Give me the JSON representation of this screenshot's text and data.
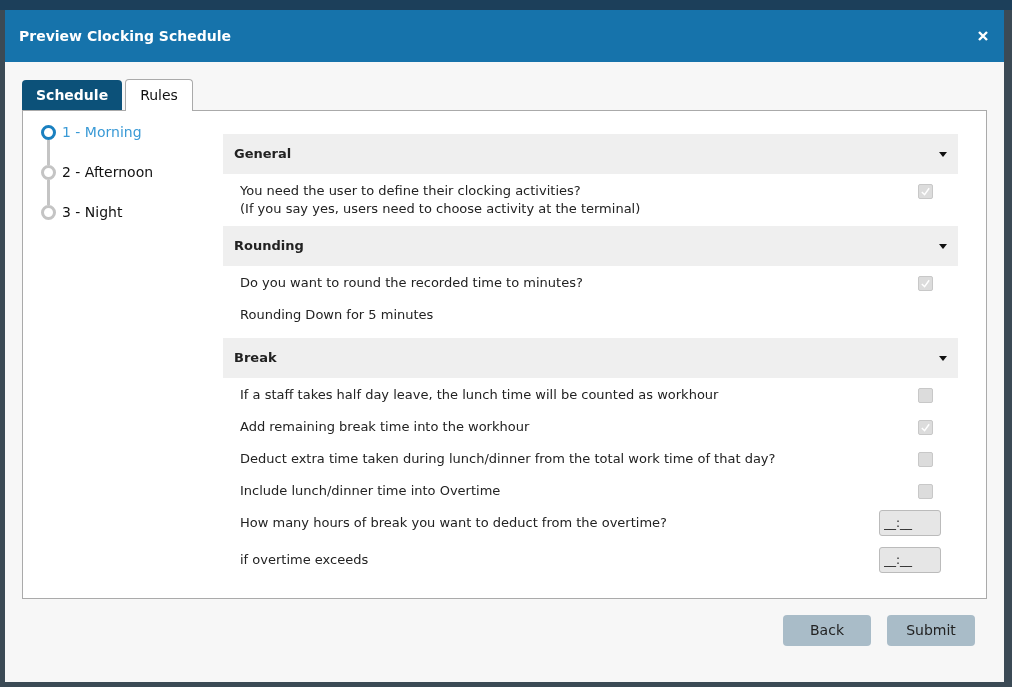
{
  "dialog": {
    "title": "Preview Clocking Schedule"
  },
  "tabs": [
    {
      "label": "Schedule",
      "selected": false
    },
    {
      "label": "Rules",
      "selected": true
    }
  ],
  "steps": [
    {
      "label": "1 - Morning",
      "selected": true
    },
    {
      "label": "2 - Afternoon",
      "selected": false
    },
    {
      "label": "3 - Night",
      "selected": false
    }
  ],
  "sections": [
    {
      "title": "General",
      "rows": [
        {
          "kind": "checkbox",
          "text": "You need the user to define their clocking activities?\n(If you say yes, users need to choose activity at the terminal)",
          "checked": true
        }
      ]
    },
    {
      "title": "Rounding",
      "rows": [
        {
          "kind": "checkbox",
          "text": "Do you want to round the recorded time to minutes?",
          "checked": true
        },
        {
          "kind": "text",
          "text": "Rounding Down for 5 minutes"
        }
      ]
    },
    {
      "title": "Break",
      "rows": [
        {
          "kind": "checkbox",
          "text": "If a staff takes half day leave, the lunch time will be counted as workhour",
          "checked": false
        },
        {
          "kind": "checkbox",
          "text": "Add remaining break time into the workhour",
          "checked": true
        },
        {
          "kind": "checkbox",
          "text": "Deduct extra time taken during lunch/dinner from the total work time of that day?",
          "checked": false
        },
        {
          "kind": "checkbox",
          "text": "Include lunch/dinner time into Overtime",
          "checked": false
        },
        {
          "kind": "time",
          "text": "How many hours of break you want to deduct from the overtime?",
          "placeholder": "__:__"
        },
        {
          "kind": "time",
          "text": "if overtime exceeds",
          "placeholder": "__:__"
        }
      ]
    }
  ],
  "buttons": [
    "Back",
    "Submit"
  ]
}
